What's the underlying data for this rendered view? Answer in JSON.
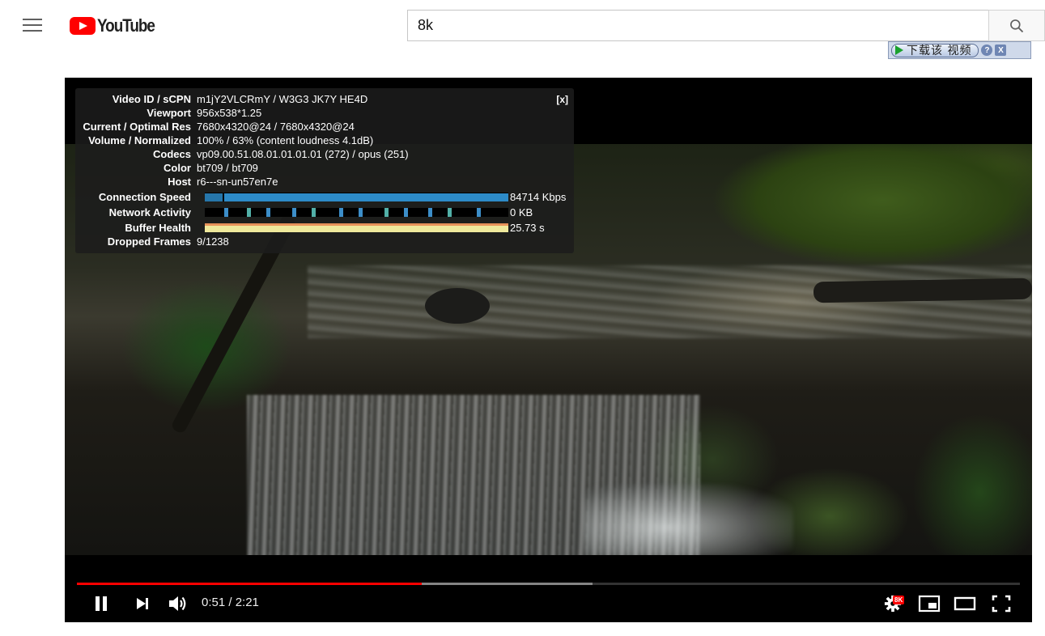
{
  "masthead": {
    "logo_text": "YouTube",
    "search": {
      "value": "8k",
      "placeholder": "Search"
    }
  },
  "download_bar": {
    "button_label": "下载该 视频",
    "help_label": "?",
    "close_label": "X"
  },
  "stats": {
    "close_label": "[x]",
    "rows": [
      {
        "label": "Video ID / sCPN",
        "value": "m1jY2VLCRmY / W3G3 JK7Y HE4D"
      },
      {
        "label": "Viewport",
        "value": "956x538*1.25"
      },
      {
        "label": "Current / Optimal Res",
        "value": "7680x4320@24 / 7680x4320@24"
      },
      {
        "label": "Volume / Normalized",
        "value": "100% / 63% (content loudness 4.1dB)"
      },
      {
        "label": "Codecs",
        "value": "vp09.00.51.08.01.01.01.01 (272) / opus (251)"
      },
      {
        "label": "Color",
        "value": "bt709 / bt709"
      },
      {
        "label": "Host",
        "value": "r6---sn-un57en7e"
      }
    ],
    "connection_speed": {
      "label": "Connection Speed",
      "value": "84714 Kbps"
    },
    "network_activity": {
      "label": "Network Activity",
      "value": "0 KB"
    },
    "buffer_health": {
      "label": "Buffer Health",
      "value": "25.73 s"
    },
    "dropped_frames": {
      "label": "Dropped Frames",
      "value": "9/1238"
    }
  },
  "controls": {
    "current_time": "0:51",
    "duration": "2:21",
    "time_display": "0:51 / 2:21",
    "played_fraction": 0.366,
    "buffered_fraction": 0.547,
    "quality_badge": "8K"
  },
  "colors": {
    "accent": "#ff0000",
    "stats_bar": "#2d8bc8",
    "buffer_bar": "#efe99c"
  }
}
